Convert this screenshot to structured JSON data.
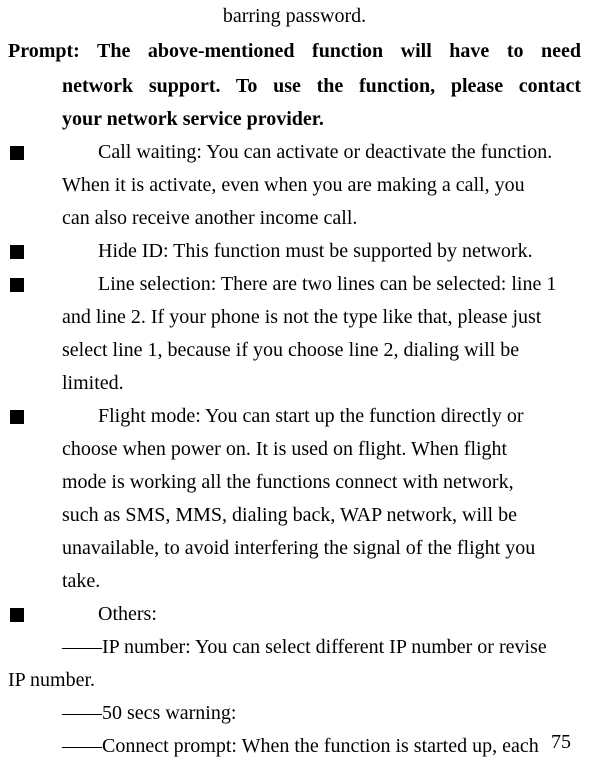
{
  "header": "barring password.",
  "prompt": {
    "line1": "Prompt: The above-mentioned function will have to need",
    "line2": "network support. To use the function, please contact",
    "line3": "your network service provider."
  },
  "items": [
    {
      "first": "Call waiting: You can activate or deactivate the function.",
      "cont": [
        "When it is activate, even when you are making a call, you",
        "can also receive another income call."
      ]
    },
    {
      "first": "Hide ID: This function must be supported by network."
    },
    {
      "first": "Line selection: There are two lines can be selected: line 1",
      "cont": [
        "and line 2. If your phone is not the type like that, please just",
        "select line 1, because if you choose line 2, dialing will be",
        "limited."
      ]
    },
    {
      "first": "Flight mode: You can start up the function directly or",
      "cont": [
        "choose when power on. It is used on flight. When flight",
        "mode is working all the functions connect with network,",
        "such as SMS, MMS, dialing back, WAP network, will be",
        "unavailable, to avoid interfering the signal of the flight you",
        "take."
      ]
    },
    {
      "first": "Others:"
    }
  ],
  "sub": {
    "ip1": "――IP number: You can select different IP number or revise",
    "ip2": "IP number.",
    "secs": "――50 secs warning:",
    "connect": "――Connect prompt: When the function is started up, each"
  },
  "pageNumber": "75"
}
